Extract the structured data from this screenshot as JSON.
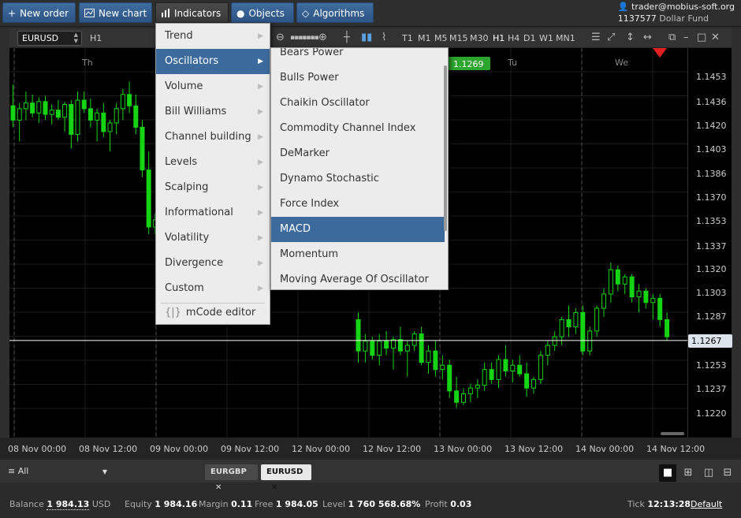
{
  "toolbar": {
    "new_order": "New order",
    "new_chart": "New chart",
    "indicators": "Indicators",
    "objects": "Objects",
    "algorithms": "Algorithms"
  },
  "account": {
    "user": "trader@mobius-soft.org",
    "id": "1137577",
    "fund": "Dollar Fund"
  },
  "chart_toolbar": {
    "symbol": "EURUSD",
    "period": "H1",
    "timeframes": [
      "T1",
      "M1",
      "M5",
      "M15",
      "M30",
      "H1",
      "H4",
      "D1",
      "W1",
      "MN1"
    ],
    "active_timeframe": "H1"
  },
  "indicators_menu": {
    "items": [
      "Trend",
      "Oscillators",
      "Volume",
      "Bill Williams",
      "Channel building",
      "Levels",
      "Scalping",
      "Informational",
      "Volatility",
      "Divergence",
      "Custom"
    ],
    "highlighted": "Oscillators",
    "editor": "mCode editor"
  },
  "oscillators_menu": {
    "items": [
      "Bears Power",
      "Bulls Power",
      "Chaikin Oscillator",
      "Commodity Channel Index",
      "DeMarker",
      "Dynamo Stochastic",
      "Force Index",
      "MACD",
      "Momentum",
      "Moving Average Of Oscillator"
    ],
    "highlighted": "MACD"
  },
  "chart": {
    "price_labels": [
      "1.1453",
      "1.1436",
      "1.1420",
      "1.1403",
      "1.1386",
      "1.1370",
      "1.1353",
      "1.1337",
      "1.1320",
      "1.1303",
      "1.1287",
      "1.1267",
      "1.1253",
      "1.1237",
      "1.1220"
    ],
    "current_price": "1.1267",
    "marker_price": "1.1269",
    "time_labels": [
      "08 Nov 00:00",
      "08 Nov 12:00",
      "09 Nov 00:00",
      "09 Nov 12:00",
      "12 Nov 00:00",
      "12 Nov 12:00",
      "13 Nov 00:00",
      "13 Nov 12:00",
      "14 Nov 00:00",
      "14 Nov 12:00"
    ],
    "day_labels": [
      "Th",
      "Tu",
      "We"
    ],
    "colors": {
      "bull": "#14d414",
      "bear": "#14d414",
      "line": "#ffffff",
      "background": "#000000"
    }
  },
  "tabs": {
    "filter": "All",
    "items": [
      "EURGBP",
      "EURUSD"
    ],
    "active": "EURUSD"
  },
  "status": {
    "balance_label": "Balance",
    "balance": "1 984.13",
    "currency": "USD",
    "equity_label": "Equity",
    "equity": "1 984.16",
    "margin_label": "Margin",
    "margin": "0.11",
    "free_label": "Free",
    "free": "1 984.05",
    "level_label": "Level",
    "level": "1 760 568.68%",
    "profit_label": "Profit",
    "profit": "0.03",
    "tick_label": "Tick",
    "tick": "12:13:28",
    "tick_source": "Default"
  },
  "candles": [
    [
      1.143,
      1.1445,
      1.1415,
      1.142
    ],
    [
      1.142,
      1.1432,
      1.1405,
      1.1428
    ],
    [
      1.1428,
      1.144,
      1.142,
      1.1432
    ],
    [
      1.1432,
      1.1438,
      1.1422,
      1.1425
    ],
    [
      1.1425,
      1.1436,
      1.1418,
      1.1433
    ],
    [
      1.1433,
      1.1437,
      1.142,
      1.1424
    ],
    [
      1.1424,
      1.1431,
      1.1417,
      1.1427
    ],
    [
      1.1427,
      1.1434,
      1.142,
      1.1422
    ],
    [
      1.1422,
      1.1433,
      1.1412,
      1.1431
    ],
    [
      1.1431,
      1.1434,
      1.14,
      1.141
    ],
    [
      1.141,
      1.144,
      1.1405,
      1.1434
    ],
    [
      1.1434,
      1.144,
      1.1425,
      1.1428
    ],
    [
      1.1428,
      1.1435,
      1.1415,
      1.142
    ],
    [
      1.142,
      1.1428,
      1.1405,
      1.1425
    ],
    [
      1.1425,
      1.1432,
      1.1408,
      1.1412
    ],
    [
      1.1412,
      1.142,
      1.1398,
      1.1418
    ],
    [
      1.1418,
      1.1432,
      1.141,
      1.1428
    ],
    [
      1.1428,
      1.1442,
      1.142,
      1.1438
    ],
    [
      1.1438,
      1.1447,
      1.1425,
      1.143
    ],
    [
      1.143,
      1.1438,
      1.141,
      1.1415
    ],
    [
      1.1415,
      1.142,
      1.138,
      1.1385
    ],
    [
      1.1385,
      1.1398,
      1.134,
      1.1345
    ],
    [
      1.1345,
      1.1355,
      1.134,
      1.135
    ],
    [
      1.128,
      1.1285,
      1.125,
      1.1258
    ],
    [
      1.1258,
      1.127,
      1.125,
      1.1265
    ],
    [
      1.1265,
      1.1268,
      1.1252,
      1.1255
    ],
    [
      1.1255,
      1.127,
      1.1248,
      1.1265
    ],
    [
      1.1265,
      1.1272,
      1.1255,
      1.126
    ],
    [
      1.126,
      1.1268,
      1.1245,
      1.1266
    ],
    [
      1.1266,
      1.1275,
      1.1255,
      1.1258
    ],
    [
      1.1258,
      1.1265,
      1.124,
      1.1262
    ],
    [
      1.1262,
      1.1272,
      1.1258,
      1.127
    ],
    [
      1.127,
      1.1275,
      1.1248,
      1.125
    ],
    [
      1.125,
      1.1262,
      1.1242,
      1.1258
    ],
    [
      1.1258,
      1.1265,
      1.124,
      1.1245
    ],
    [
      1.1245,
      1.1255,
      1.1238,
      1.1248
    ],
    [
      1.1248,
      1.1252,
      1.1225,
      1.123
    ],
    [
      1.123,
      1.124,
      1.1218,
      1.1222
    ],
    [
      1.1222,
      1.1232,
      1.122,
      1.1228
    ],
    [
      1.1228,
      1.1235,
      1.1222,
      1.1232
    ],
    [
      1.1232,
      1.1238,
      1.1225,
      1.1234
    ],
    [
      1.1234,
      1.125,
      1.123,
      1.1245
    ],
    [
      1.1245,
      1.125,
      1.1235,
      1.1238
    ],
    [
      1.1238,
      1.1255,
      1.1232,
      1.1252
    ],
    [
      1.1252,
      1.1262,
      1.124,
      1.1244
    ],
    [
      1.1244,
      1.1252,
      1.1236,
      1.1248
    ],
    [
      1.1248,
      1.1255,
      1.124,
      1.1242
    ],
    [
      1.1242,
      1.125,
      1.1226,
      1.1232
    ],
    [
      1.1232,
      1.124,
      1.1228,
      1.1238
    ],
    [
      1.1238,
      1.1258,
      1.1235,
      1.1255
    ],
    [
      1.1255,
      1.1265,
      1.1248,
      1.1262
    ],
    [
      1.1262,
      1.1272,
      1.1258,
      1.1268
    ],
    [
      1.1268,
      1.1282,
      1.1262,
      1.128
    ],
    [
      1.128,
      1.129,
      1.1268,
      1.1275
    ],
    [
      1.1275,
      1.1288,
      1.127,
      1.1285
    ],
    [
      1.1285,
      1.129,
      1.1255,
      1.1258
    ],
    [
      1.1258,
      1.1275,
      1.1255,
      1.1272
    ],
    [
      1.1272,
      1.129,
      1.1268,
      1.1288
    ],
    [
      1.1288,
      1.1302,
      1.1282,
      1.1298
    ],
    [
      1.1298,
      1.132,
      1.1292,
      1.1315
    ],
    [
      1.1315,
      1.1318,
      1.13,
      1.1305
    ],
    [
      1.1305,
      1.1312,
      1.1298,
      1.131
    ],
    [
      1.131,
      1.1312,
      1.1292,
      1.1296
    ],
    [
      1.1296,
      1.1305,
      1.1285,
      1.13
    ],
    [
      1.13,
      1.1302,
      1.1288,
      1.1292
    ],
    [
      1.1292,
      1.1298,
      1.128,
      1.1295
    ],
    [
      1.1295,
      1.1298,
      1.1275,
      1.128
    ],
    [
      1.128,
      1.1285,
      1.1265,
      1.1268
    ]
  ]
}
